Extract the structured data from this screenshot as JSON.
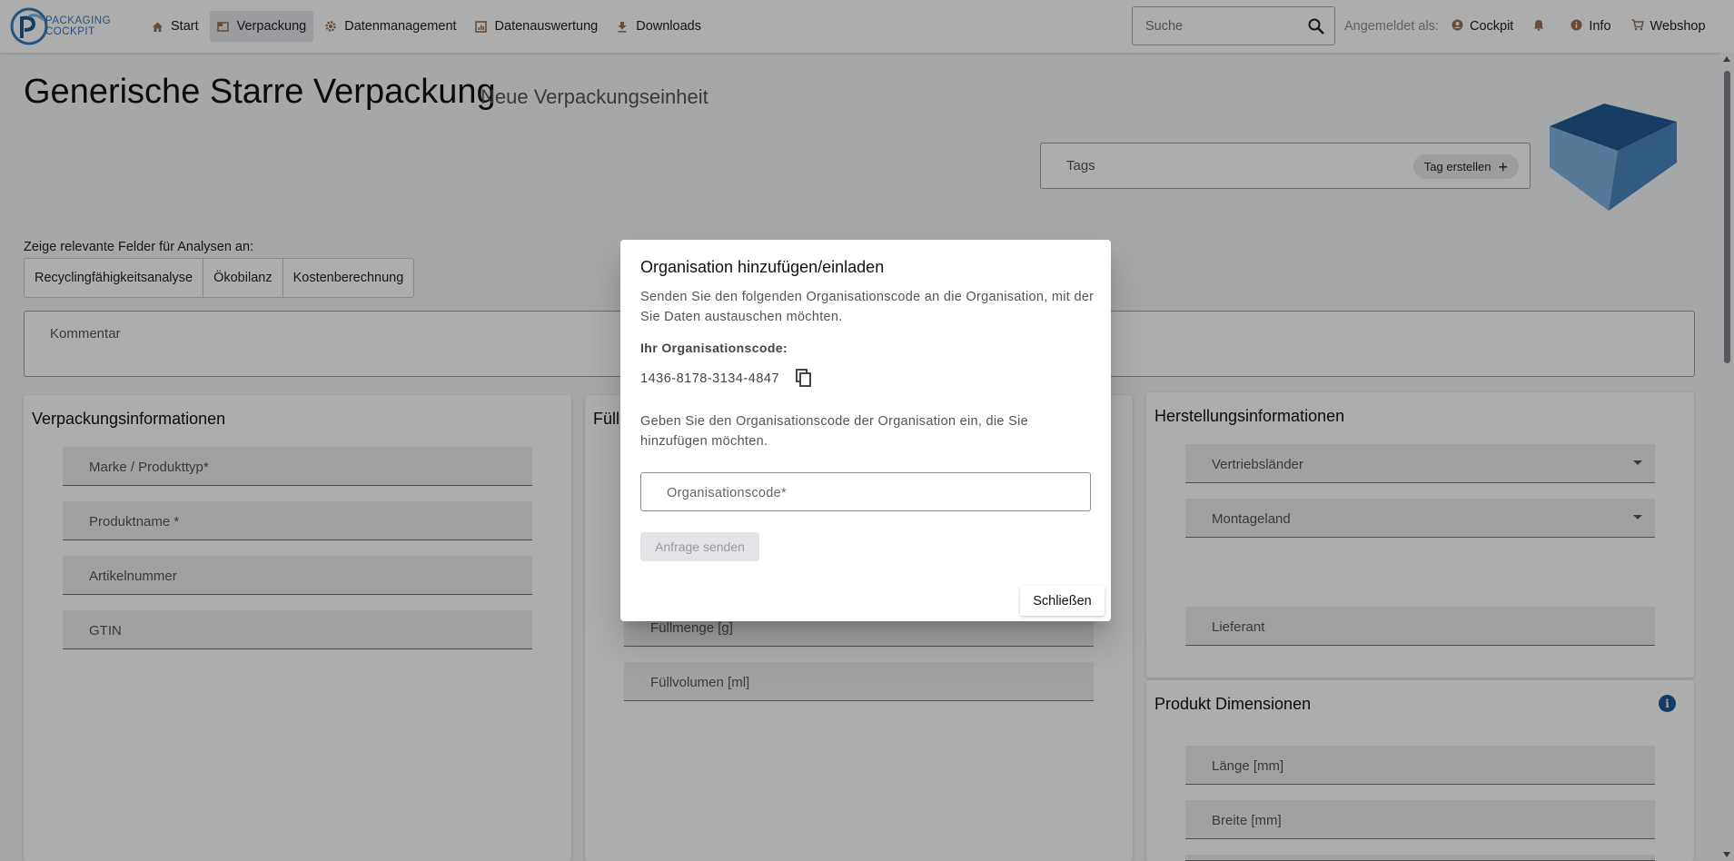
{
  "brand": {
    "logo_line1": "PACKAGING",
    "logo_line2": "COCKPIT"
  },
  "nav": {
    "items": [
      {
        "label": "Start",
        "icon": "home-icon"
      },
      {
        "label": "Verpackung",
        "icon": "package-icon"
      },
      {
        "label": "Datenmanagement",
        "icon": "gear-icon"
      },
      {
        "label": "Datenauswertung",
        "icon": "chart-icon"
      },
      {
        "label": "Downloads",
        "icon": "download-icon"
      }
    ],
    "search_placeholder": "Suche",
    "logged_in_label": "Angemeldet als:",
    "user": "Cockpit",
    "info": "Info",
    "webshop": "Webshop"
  },
  "page": {
    "title": "Generische Starre Verpackung",
    "subtitle": "Neue Verpackungseinheit",
    "tags_label": "Tags",
    "tag_button": "Tag erstellen",
    "analysis_label": "Zeige relevante Felder für Analysen an:",
    "analysis_buttons": [
      "Recyclingfähigkeitsanalyse",
      "Ökobilanz",
      "Kostenberechnung"
    ],
    "comment_label": "Kommentar"
  },
  "cards": {
    "packaging_info": {
      "title": "Verpackungsinformationen",
      "fields": [
        "Marke / Produkttyp*",
        "Produktname *",
        "Artikelnummer",
        "GTIN"
      ]
    },
    "filling": {
      "title": "Füll",
      "fields": [
        "Füllmenge [g]",
        "Füllvolumen [ml]"
      ]
    },
    "manufacturing": {
      "title": "Herstellungsinformationen",
      "fields": [
        "Vertriebsländer",
        "Montageland",
        "Lieferant"
      ]
    },
    "dimensions": {
      "title": "Produkt Dimensionen",
      "fields": [
        "Länge [mm]",
        "Breite [mm]"
      ]
    }
  },
  "dialog": {
    "title": "Organisation hinzufügen/einladen",
    "intro": "Senden Sie den folgenden Organisationscode an die Organisation, mit der Sie Daten austauschen möchten.",
    "code_label": "Ihr Organisationscode:",
    "code": "1436-8178-3134-4847",
    "enter_text": "Geben Sie den Organisationscode der Organisation ein, die Sie hinzufügen möchten.",
    "input_label": "Organisationscode*",
    "send_button": "Anfrage senden",
    "close_button": "Schließen"
  },
  "colors": {
    "accent_brown": "#9a7256",
    "brand_blue": "#1d5b96",
    "box_front": "#7fb3e0",
    "box_top": "#1f5a94"
  }
}
